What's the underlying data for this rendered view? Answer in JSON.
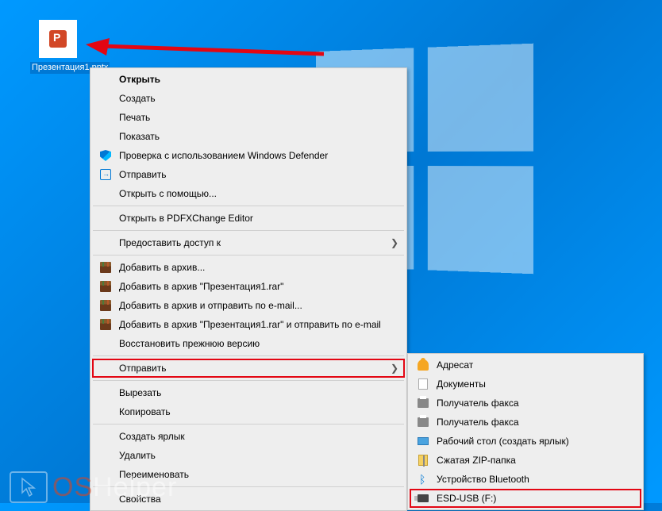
{
  "desktop": {
    "file_name": "Презентация1.pptx"
  },
  "context_menu": {
    "open": "Открыть",
    "create": "Создать",
    "print": "Печать",
    "show": "Показать",
    "defender": "Проверка с использованием Windows Defender",
    "send": "Отправить",
    "open_with": "Открыть с помощью...",
    "pdfx": "Открыть в PDFXChange Editor",
    "grant_access": "Предоставить доступ к",
    "rar_add": "Добавить в архив...",
    "rar_add_named": "Добавить в архив \"Презентация1.rar\"",
    "rar_send": "Добавить в архив и отправить по e-mail...",
    "rar_send_named": "Добавить в архив \"Презентация1.rar\" и отправить по e-mail",
    "restore": "Восстановить прежнюю версию",
    "send_to": "Отправить",
    "cut": "Вырезать",
    "copy": "Копировать",
    "shortcut": "Создать ярлык",
    "delete": "Удалить",
    "rename": "Переименовать",
    "properties": "Свойства"
  },
  "submenu": {
    "recipient": "Адресат",
    "documents": "Документы",
    "fax1": "Получатель факса",
    "fax2": "Получатель факса",
    "desktop_shortcut": "Рабочий стол (создать ярлык)",
    "zip": "Сжатая ZIP-папка",
    "bluetooth": "Устройство Bluetooth",
    "usb": "ESD-USB (F:)"
  },
  "watermark": {
    "os": "OS",
    "helper": "Helper"
  }
}
